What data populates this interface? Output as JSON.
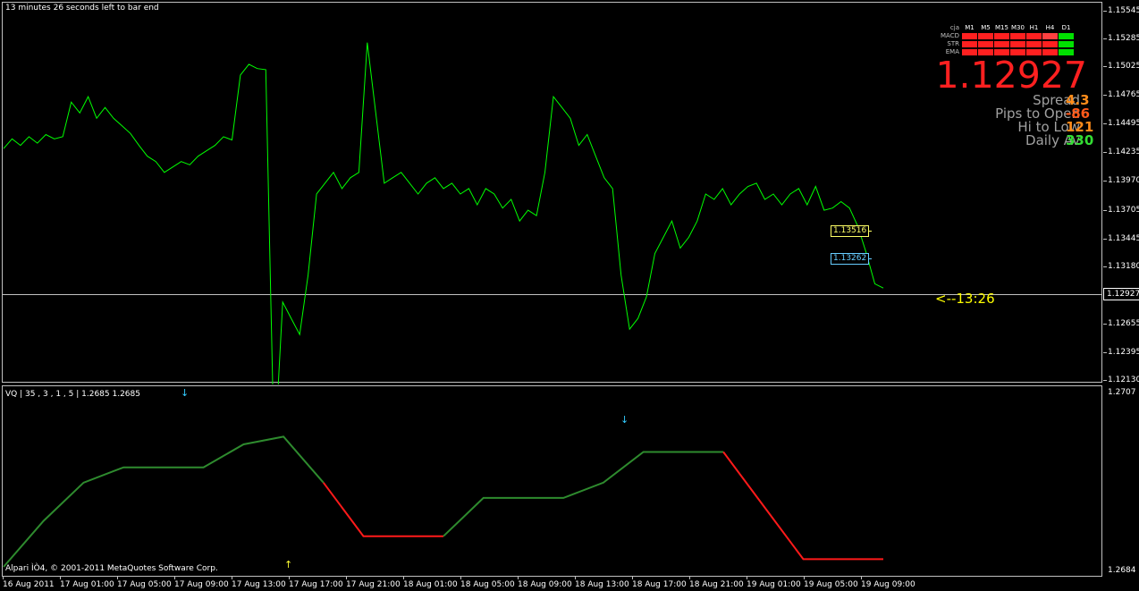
{
  "timer_text": "13 minutes 26 seconds left to bar end",
  "countdown": "<--13:26",
  "main_yaxis": [
    "1.15545",
    "1.15285",
    "1.15025",
    "1.14765",
    "1.14495",
    "1.14235",
    "1.13970",
    "1.13705",
    "1.13445",
    "1.13180",
    "1.12927",
    "1.12655",
    "1.12395",
    "1.12130"
  ],
  "current_price": "1.12927",
  "levels": [
    {
      "label": "1.13516",
      "color": "#ffff66"
    },
    {
      "label": "1.13262",
      "color": "#66ccff"
    }
  ],
  "dashboard": {
    "corner": "cja",
    "timeframes": [
      "M1",
      "M5",
      "M15",
      "M30",
      "H1",
      "H4",
      "D1"
    ],
    "rows": [
      {
        "name": "MACD",
        "colors": [
          "#ff2020",
          "#ff2020",
          "#ff2020",
          "#ff2020",
          "#ff2020",
          "#ff4040",
          "#00e000"
        ]
      },
      {
        "name": "STR",
        "colors": [
          "#ff2020",
          "#ff2020",
          "#ff2020",
          "#ff2020",
          "#ff2020",
          "#ff2020",
          "#00e000"
        ]
      },
      {
        "name": "EMA",
        "colors": [
          "#ff2020",
          "#ff2020",
          "#ff2020",
          "#ff2020",
          "#ff2020",
          "#ff2020",
          "#00e000"
        ]
      }
    ],
    "big_price": "1.12927",
    "stats": [
      {
        "label": "Spread",
        "value": "4.3",
        "color": "#ff8c1a"
      },
      {
        "label": "Pips to Open",
        "value": "-86",
        "color": "#ff5a1a"
      },
      {
        "label": "Hi to Low",
        "value": "121",
        "color": "#ff8c1a"
      },
      {
        "label": "Daily Av",
        "value": "330",
        "color": "#33dd33"
      }
    ]
  },
  "indicator": {
    "title": "VQ | 35 , 3 , 1 , 5  | 1.2685 1.2685",
    "ytop": "1.2707",
    "ybottom": "1.2684",
    "arrow_down": "↓",
    "arrow_up": "↑"
  },
  "copyright": "Alpari ÌÒ4, © 2001-2011 MetaQuotes Software Corp.",
  "xaxis": [
    "16 Aug 2011",
    "17 Aug 01:00",
    "17 Aug 05:00",
    "17 Aug 09:00",
    "17 Aug 13:00",
    "17 Aug 17:00",
    "17 Aug 21:00",
    "18 Aug 01:00",
    "18 Aug 05:00",
    "18 Aug 09:00",
    "18 Aug 13:00",
    "18 Aug 17:00",
    "18 Aug 21:00",
    "19 Aug 01:00",
    "19 Aug 05:00",
    "19 Aug 09:00"
  ],
  "colors": {
    "price_line": "#00ff00",
    "vq_up": "#2e8b2e",
    "vq_down": "#ff1a1a",
    "grid": "#c0c0c0"
  },
  "chart_data": [
    {
      "type": "line",
      "series": [
        {
          "values": [
            1.1427,
            1.1436,
            1.143,
            1.1438,
            1.1432,
            1.144,
            1.1436,
            1.1438,
            1.147,
            1.146,
            1.1475,
            1.1455,
            1.1465,
            1.1455,
            1.1448,
            1.1441,
            1.143,
            1.142,
            1.1415,
            1.1405,
            1.141,
            1.1415,
            1.1412,
            1.142,
            1.1425,
            1.143,
            1.1438,
            1.1435,
            1.1495,
            1.1505,
            1.1501,
            1.15,
            1.114,
            1.1285,
            1.127,
            1.1255,
            1.131,
            1.1385,
            1.1395,
            1.1405,
            1.139,
            1.14,
            1.1405,
            1.1525,
            1.146,
            1.1395,
            1.14,
            1.1405,
            1.1395,
            1.1385,
            1.1395,
            1.14,
            1.139,
            1.1395,
            1.1385,
            1.139,
            1.1375,
            1.139,
            1.1385,
            1.1372,
            1.138,
            1.136,
            1.137,
            1.1365,
            1.1405,
            1.1475,
            1.1465,
            1.1455,
            1.143,
            1.144,
            1.142,
            1.14,
            1.139,
            1.131,
            1.126,
            1.127,
            1.129,
            1.133,
            1.1345,
            1.136,
            1.1335,
            1.1345,
            1.136,
            1.1385,
            1.138,
            1.139,
            1.1375,
            1.1385,
            1.1392,
            1.1395,
            1.138,
            1.1385,
            1.1375,
            1.1385,
            1.139,
            1.1375,
            1.1392,
            1.137,
            1.1372,
            1.1378,
            1.1372,
            1.1355,
            1.133,
            1.1302,
            1.1298
          ]
        }
      ],
      "ylim": [
        1.1213,
        1.15545
      ]
    },
    {
      "type": "line",
      "series": [
        {
          "values": [
            1.2684,
            1.269,
            1.2695,
            1.2697,
            1.2697,
            1.2697,
            1.27,
            1.2701,
            1.2695,
            1.2688,
            1.2688,
            1.2688,
            1.2693,
            1.2693,
            1.2693,
            1.2695,
            1.2699,
            1.2699,
            1.2699,
            1.2692,
            1.2685,
            1.2685,
            1.2685
          ]
        }
      ],
      "ylim": [
        1.2684,
        1.2707
      ]
    }
  ]
}
